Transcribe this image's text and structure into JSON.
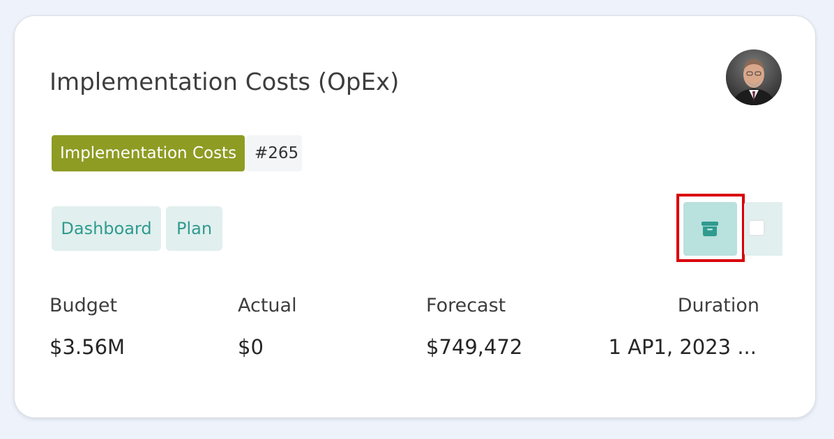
{
  "card": {
    "title": "Implementation Costs (OpEx)",
    "category_tag": "Implementation Costs",
    "id_tag": "#265",
    "colors": {
      "category_tag_bg": "#8e9c24",
      "accent_teal": "#2f9b8f",
      "highlight": "#d9000b"
    }
  },
  "nav": {
    "dashboard_label": "Dashboard",
    "plan_label": "Plan"
  },
  "actions": {
    "archive_icon": "archive-icon",
    "select_checkbox_checked": false
  },
  "stats": {
    "budget_label": "Budget",
    "budget_value": "$3.56M",
    "actual_label": "Actual",
    "actual_value": "$0",
    "forecast_label": "Forecast",
    "forecast_value": "$749,472",
    "duration_label": "Duration",
    "duration_value": "1 AP1, 2023 ..."
  }
}
